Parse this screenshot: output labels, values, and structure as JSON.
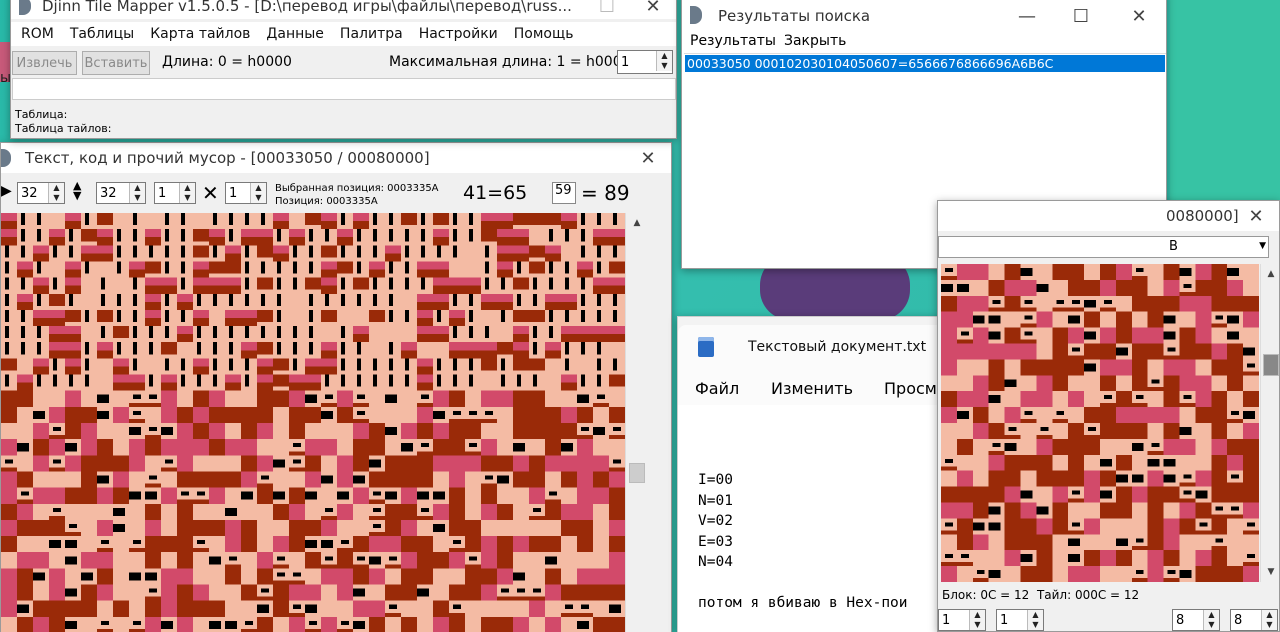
{
  "tile_mapper": {
    "title": "Djinn Tile Mapper v1.5.0.5 - [D:\\перевод игры\\файлы\\перевод\\russ...",
    "menu": [
      "ROM",
      "Таблицы",
      "Карта тайлов",
      "Данные",
      "Палитра",
      "Настройки",
      "Помощь"
    ],
    "extract_label": "Извлечь",
    "insert_label": "Вставить",
    "length_text": "Длина: 0 = h0000",
    "max_length_text": "Максимальная длина: 1 = h0001",
    "spin_value": "1",
    "table_label": "Таблица:",
    "tile_table_label": "Таблица тайлов:"
  },
  "text_window": {
    "title": "Текст, код и прочий мусор - [00033050 / 00080000]",
    "spin_width": "32",
    "spin_height": "32",
    "spin_a": "1",
    "spin_b": "1",
    "selected_pos": "Выбранная позиция: 0003335A",
    "position": "Позиция: 0003335A",
    "code_text": "41=65",
    "value_box": "59",
    "value_eq": "= 89"
  },
  "search_results": {
    "title": "Результаты поиска",
    "menu": [
      "Результаты",
      "Закрыть"
    ],
    "result_line": "00033050 000102030104050607=6566676866696A6B6C"
  },
  "notepad": {
    "tab_title": "Текстовый документ.txt",
    "menu": [
      "Файл",
      "Изменить",
      "Просм"
    ],
    "lines": [
      "I=00",
      "N=01",
      "V=02",
      "E=03",
      "N=04"
    ],
    "last_line": "потом я вбиваю в Hex-пои"
  },
  "tile_window": {
    "title_fragment": "0080000]",
    "combo_fragment": "B",
    "status_text": "Блок: 0С = 12  Тайл: 000С = 12",
    "spin_1": "1",
    "spin_2": "1",
    "spin_3": "8",
    "spin_4": "8"
  },
  "background_fragment": "ы",
  "colors": {
    "tile_light": "#f4bba4",
    "tile_red": "#d24a6a",
    "tile_brown": "#9a2a08",
    "selection": "#0078d7"
  }
}
